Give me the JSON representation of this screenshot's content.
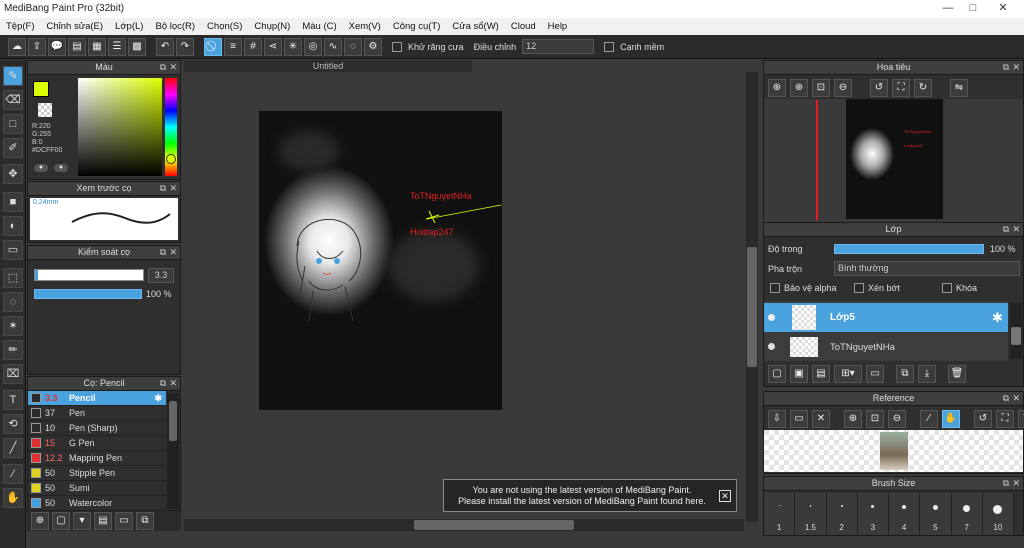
{
  "window": {
    "title": "MediBang Paint Pro (32bit)",
    "min": "—",
    "max": "□",
    "close": "✕"
  },
  "menu": [
    "Tệp(F)",
    "Chỉnh sửa(E)",
    "Lớp(L)",
    "Bộ lọc(R)",
    "Chọn(S)",
    "Chụp(N)",
    "Màu (C)",
    "Xem(V)",
    "Công cụ(T)",
    "Cửa sổ(W)",
    "Cloud",
    "Help"
  ],
  "toolbar": {
    "antialias_label": "Khử răng cưa",
    "correction_label": "Điều chỉnh",
    "correction_value": "12",
    "edge_label": "Cạnh mềm"
  },
  "color_panel": {
    "title": "Màu",
    "r": "R:220",
    "g": "G:255",
    "b": "B:0",
    "hex": "#DCFF00",
    "primary": "#DCFF00"
  },
  "preview_panel": {
    "title": "Xem trước cọ",
    "size": "0.24mm"
  },
  "control_panel": {
    "title": "Kiểm soát cọ",
    "size_value": "3.3",
    "opacity_value": "100 %"
  },
  "brush_panel": {
    "title": "Cọ: Pencil",
    "brushes": [
      {
        "size": "3.3",
        "name": "Pencil",
        "color": "#2a2a2a",
        "selected": true
      },
      {
        "size": "37",
        "name": "Pen",
        "color": "#2a2a2a"
      },
      {
        "size": "10",
        "name": "Pen (Sharp)",
        "color": "#2a2a2a"
      },
      {
        "size": "15",
        "name": "G Pen",
        "color": "#e03030"
      },
      {
        "size": "12.2",
        "name": "Mapping Pen",
        "color": "#e03030"
      },
      {
        "size": "50",
        "name": "Stipple Pen",
        "color": "#e0d020"
      },
      {
        "size": "50",
        "name": "Sumi",
        "color": "#e0d020"
      },
      {
        "size": "50",
        "name": "Watercolor",
        "color": "#40a0e0"
      }
    ]
  },
  "canvas": {
    "tab": "Untitled",
    "text1": "ToTNguyetNHa",
    "text2": "Hoidap247"
  },
  "notice": {
    "line1": "You are not using the latest version of MediBang Paint.",
    "line2": "Please install the latest version of MediBang Paint found here."
  },
  "navigator": {
    "title": "Hoa tiêu",
    "mini_text1": "ToTNguyetNHa",
    "mini_text2": "Hoidap247"
  },
  "layer_panel": {
    "title": "Lớp",
    "opacity_label": "Độ trong",
    "opacity_value": "100 %",
    "blend_label": "Pha trộn",
    "blend_value": "Bình thường",
    "protect_alpha": "Bảo vệ alpha",
    "clipping": "Xén bớt",
    "lock": "Khóa",
    "layers": [
      {
        "name": "Lớp5",
        "selected": true
      },
      {
        "name": "ToTNguyetNHa",
        "selected": false
      }
    ]
  },
  "reference": {
    "title": "Reference"
  },
  "brush_size": {
    "title": "Brush Size",
    "sizes": [
      "1",
      "1.5",
      "2",
      "3",
      "4",
      "5",
      "7",
      "10"
    ]
  }
}
